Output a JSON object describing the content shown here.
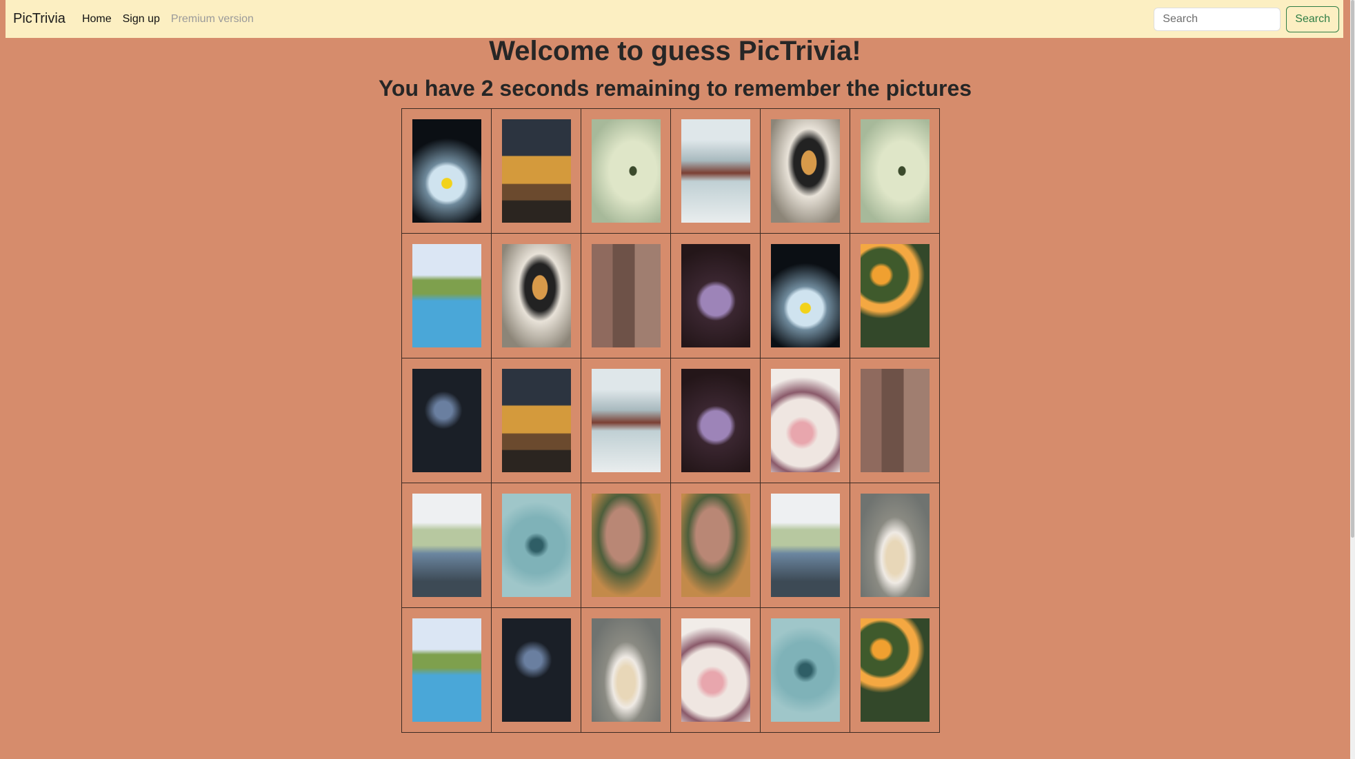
{
  "navbar": {
    "brand": "PicTrivia",
    "links": [
      "Home",
      "Sign up"
    ],
    "disabled_link": "Premium version",
    "search_placeholder": "Search",
    "search_button": "Search"
  },
  "main": {
    "title": "Welcome to guess PicTrivia!",
    "subtitle": "You have 2 seconds remaining to remember the pictures"
  },
  "grid": {
    "rows": [
      [
        "splash-glass",
        "pancake-stack",
        "crocodile-water",
        "surfer-wave",
        "compact-mirror-eye",
        "crocodile-water"
      ],
      [
        "icecream-pool-palms",
        "compact-mirror-eye",
        "wall-bicycle-woman",
        "purple-popsicle-berries",
        "splash-glass",
        "orange-flowers"
      ],
      [
        "motocross-jump",
        "pancake-stack",
        "surfer-wave",
        "purple-popsicle-berries",
        "serum-bottle-flowers",
        "wall-bicycle-woman"
      ],
      [
        "flower-market-tent",
        "blue-succulent",
        "tattooed-legs-flowers",
        "tattooed-legs-flowers",
        "flower-market-tent",
        "blonde-hair-plate"
      ],
      [
        "icecream-pool-palms",
        "motocross-jump",
        "blonde-hair-plate",
        "serum-bottle-flowers",
        "blue-succulent",
        "orange-flowers"
      ]
    ]
  },
  "colors": {
    "page_background": "#d68c6c",
    "navbar_background": "#fcefc2",
    "search_button_accent": "#2e7d45"
  }
}
